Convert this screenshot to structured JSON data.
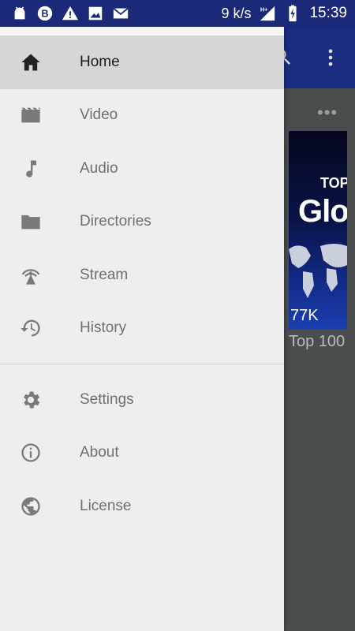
{
  "status_bar": {
    "speed": "9 k/s",
    "time": "15:39",
    "icons": [
      "android-icon",
      "b-badge-icon",
      "warning-icon",
      "image-icon",
      "mail-icon",
      "hplus-signal-icon",
      "battery-charging-icon"
    ]
  },
  "background_app": {
    "thumbnail": {
      "overlay_top": "TOP",
      "overlay_big": "Glo",
      "views": "77K"
    },
    "item_title": "Top 100"
  },
  "drawer": {
    "primary_items": [
      {
        "label": "Home",
        "icon": "home-icon",
        "active": true
      },
      {
        "label": "Video",
        "icon": "video-clapper-icon"
      },
      {
        "label": "Audio",
        "icon": "music-note-icon"
      },
      {
        "label": "Directories",
        "icon": "folder-icon"
      },
      {
        "label": "Stream",
        "icon": "broadcast-tower-icon"
      },
      {
        "label": "History",
        "icon": "history-icon"
      }
    ],
    "secondary_items": [
      {
        "label": "Settings",
        "icon": "gear-icon"
      },
      {
        "label": "About",
        "icon": "info-icon"
      },
      {
        "label": "License",
        "icon": "globe-icon"
      }
    ]
  },
  "colors": {
    "status_bar": "#1a2a78",
    "toolbar": "#1b2d80",
    "drawer_bg": "#eeeeee",
    "active_item_bg": "#d6d6d6"
  }
}
